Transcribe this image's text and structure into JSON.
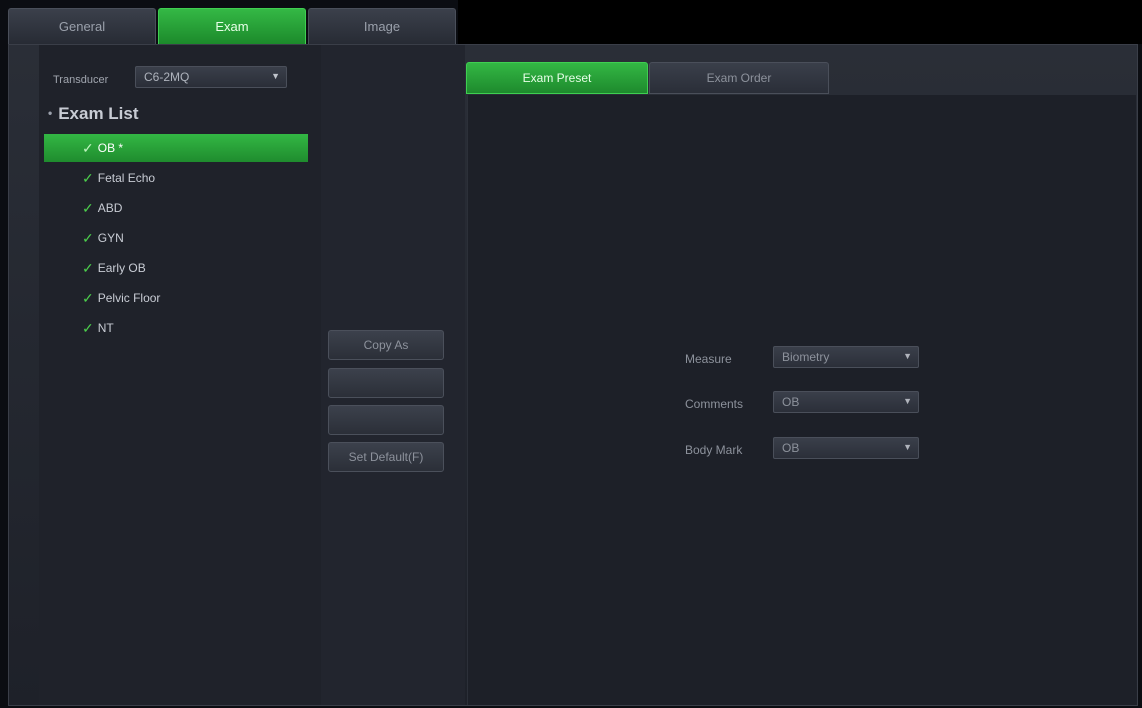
{
  "top_tabs": [
    "General",
    "Exam",
    "Image"
  ],
  "active_top_tab": "Exam",
  "transducer": {
    "label": "Transducer",
    "value": "C6-2MQ"
  },
  "exam_list": {
    "title": "Exam List",
    "items": [
      "OB *",
      "Fetal Echo",
      "ABD",
      "GYN",
      "Early OB",
      "Pelvic Floor",
      "NT"
    ],
    "selected": "OB *"
  },
  "mid_buttons": {
    "copy_as": "Copy As",
    "blank_1": "",
    "blank_2": "",
    "set_default": "Set Default(F)"
  },
  "sub_tabs": [
    "Exam Preset",
    "Exam Order"
  ],
  "active_sub_tab": "Exam Preset",
  "fields": [
    {
      "label": "Measure",
      "value": "Biometry"
    },
    {
      "label": "Comments",
      "value": "OB"
    },
    {
      "label": "Body Mark",
      "value": "OB"
    }
  ],
  "colors": {
    "accent_green": "#2aa83a",
    "panel_bg": "#1f222a",
    "text": "#c8ccd4"
  }
}
